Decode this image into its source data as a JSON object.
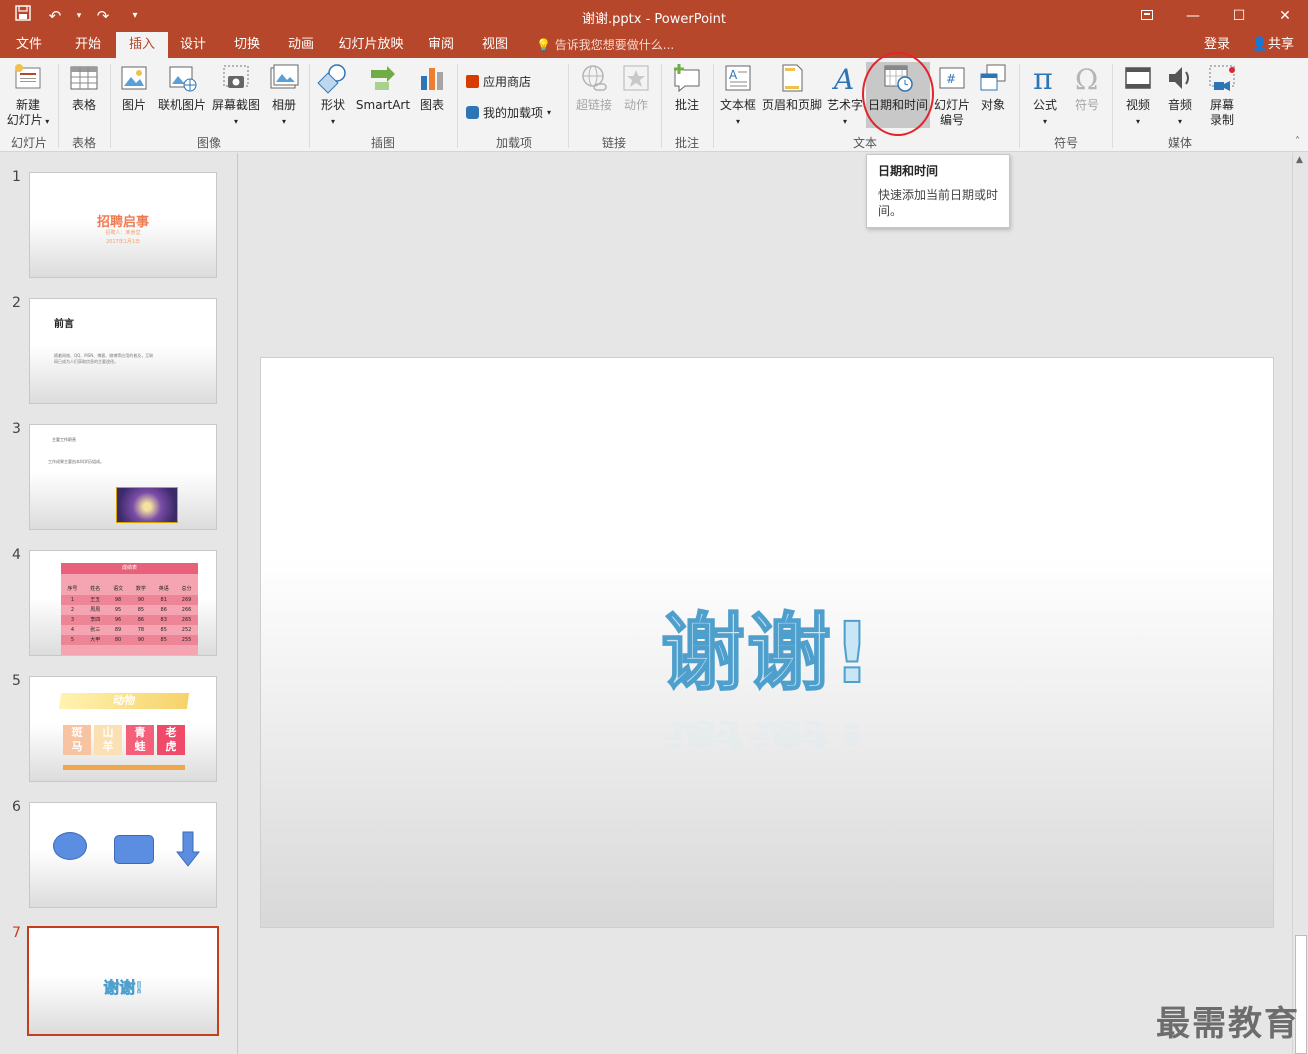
{
  "titlebar": {
    "title": "谢谢.pptx - PowerPoint",
    "qat": [
      "save-icon",
      "undo-icon",
      "redo-icon",
      "customize-icon"
    ],
    "window_controls": [
      "restore-ribbon-icon",
      "minimize-icon",
      "maximize-icon",
      "close-icon"
    ]
  },
  "tabs": [
    "文件",
    "开始",
    "插入",
    "设计",
    "切换",
    "动画",
    "幻灯片放映",
    "审阅",
    "视图"
  ],
  "active_tab": "插入",
  "tell_me": "告诉我您想要做什么...",
  "login": "登录",
  "share": "共享",
  "ribbon": {
    "new_slide": "新建\n幻灯片",
    "table": "表格",
    "picture": "图片",
    "online_picture": "联机图片",
    "screenshot": "屏幕截图",
    "album": "相册",
    "shapes": "形状",
    "smartart": "SmartArt",
    "chart": "图表",
    "store": "应用商店",
    "my_addins": "我的加载项",
    "hyperlink": "超链接",
    "action": "动作",
    "comment": "批注",
    "textbox": "文本框",
    "header_footer": "页眉和页脚",
    "wordart": "艺术字",
    "date_time": "日期和时间",
    "slide_number": "幻灯片\n编号",
    "object": "对象",
    "equation": "公式",
    "symbol": "符号",
    "video": "视频",
    "audio": "音频",
    "screen_record": "屏幕\n录制",
    "groups": {
      "slides": "幻灯片",
      "tables": "表格",
      "images": "图像",
      "illustrations": "插图",
      "addins": "加载项",
      "links": "链接",
      "comments": "批注",
      "text": "文本",
      "symbols": "符号",
      "media": "媒体"
    }
  },
  "tooltip": {
    "title": "日期和时间",
    "desc": "快速添加当前日期或时间。"
  },
  "thumbnails": [
    {
      "num": "1",
      "title": "招聘启事",
      "sub1": "招聘人：某食堂",
      "sub2": "2017年1月1日"
    },
    {
      "num": "2",
      "title": "前言",
      "body": "随着网络、QQ、MSN、博客、微博等应用的普及，互联网已成为人们获取信息的主要途径。"
    },
    {
      "num": "3",
      "title": "主要工作职责",
      "body": "工作成果主要由本科学历组成。"
    },
    {
      "num": "4",
      "title": "成绩表",
      "headers": [
        "序号",
        "姓名",
        "语文",
        "数学",
        "英语",
        "总分"
      ],
      "rows": [
        [
          "1",
          "王五",
          "98",
          "90",
          "81",
          "269"
        ],
        [
          "2",
          "周周",
          "95",
          "85",
          "86",
          "266"
        ],
        [
          "3",
          "李四",
          "96",
          "86",
          "83",
          "265"
        ],
        [
          "4",
          "张三",
          "89",
          "78",
          "85",
          "252"
        ],
        [
          "5",
          "大甲",
          "80",
          "90",
          "85",
          "255"
        ]
      ]
    },
    {
      "num": "5",
      "title": "动物",
      "cells": [
        "斑马",
        "山羊",
        "青蛙",
        "老虎"
      ]
    },
    {
      "num": "6"
    },
    {
      "num": "7",
      "title": "谢谢!"
    }
  ],
  "slide": {
    "text": "谢谢!"
  },
  "watermark": "最需教育",
  "colors": {
    "accent": "#b7472a",
    "selected_thumb": "#c43e1c",
    "highlight_circle": "#e0252d"
  }
}
